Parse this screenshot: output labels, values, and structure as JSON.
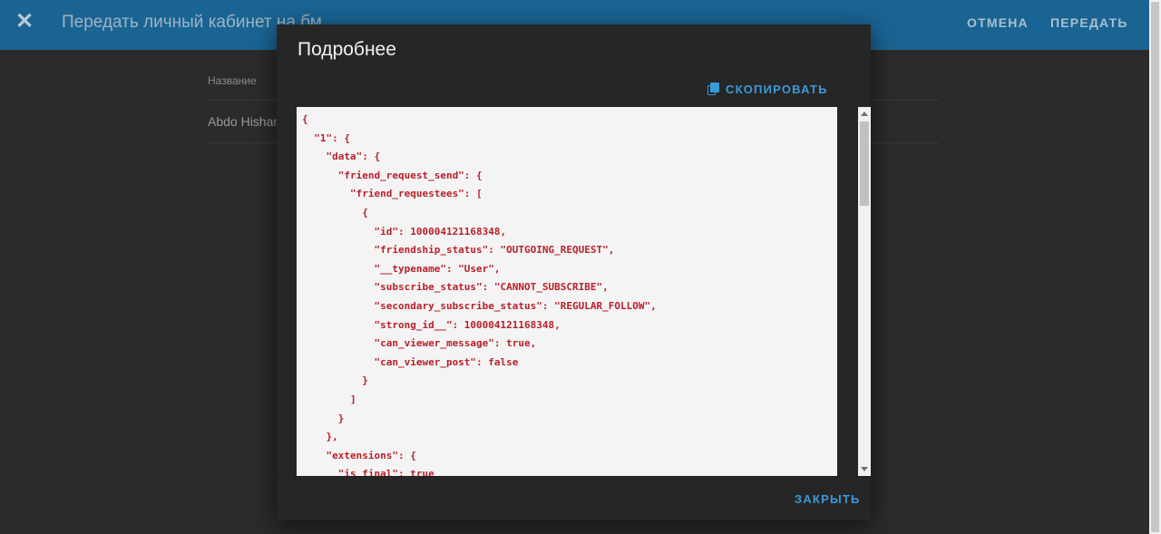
{
  "topbar": {
    "close_icon": "close-icon",
    "title": "Передать личный кабинет на бм",
    "cancel_label": "ОТМЕНА",
    "transfer_label": "ПЕРЕДАТЬ",
    "bar_color": "#1a6493"
  },
  "table": {
    "column_header": "Название",
    "rows": [
      {
        "name": "Abdo Hishan"
      }
    ]
  },
  "modal": {
    "title": "Подробнее",
    "copy_label": "СКОПИРОВАТЬ",
    "copy_icon": "copy-icon",
    "close_label": "ЗАКРЫТЬ",
    "accent_color": "#3a9ad9",
    "code_color": "#b8202a",
    "code": "{\n  \"1\": {\n    \"data\": {\n      \"friend_request_send\": {\n        \"friend_requestees\": [\n          {\n            \"id\": 100004121168348,\n            \"friendship_status\": \"OUTGOING_REQUEST\",\n            \"__typename\": \"User\",\n            \"subscribe_status\": \"CANNOT_SUBSCRIBE\",\n            \"secondary_subscribe_status\": \"REGULAR_FOLLOW\",\n            \"strong_id__\": 100004121168348,\n            \"can_viewer_message\": true,\n            \"can_viewer_post\": false\n          }\n        ]\n      }\n    },\n    \"extensions\": {\n      \"is_final\": true"
  }
}
